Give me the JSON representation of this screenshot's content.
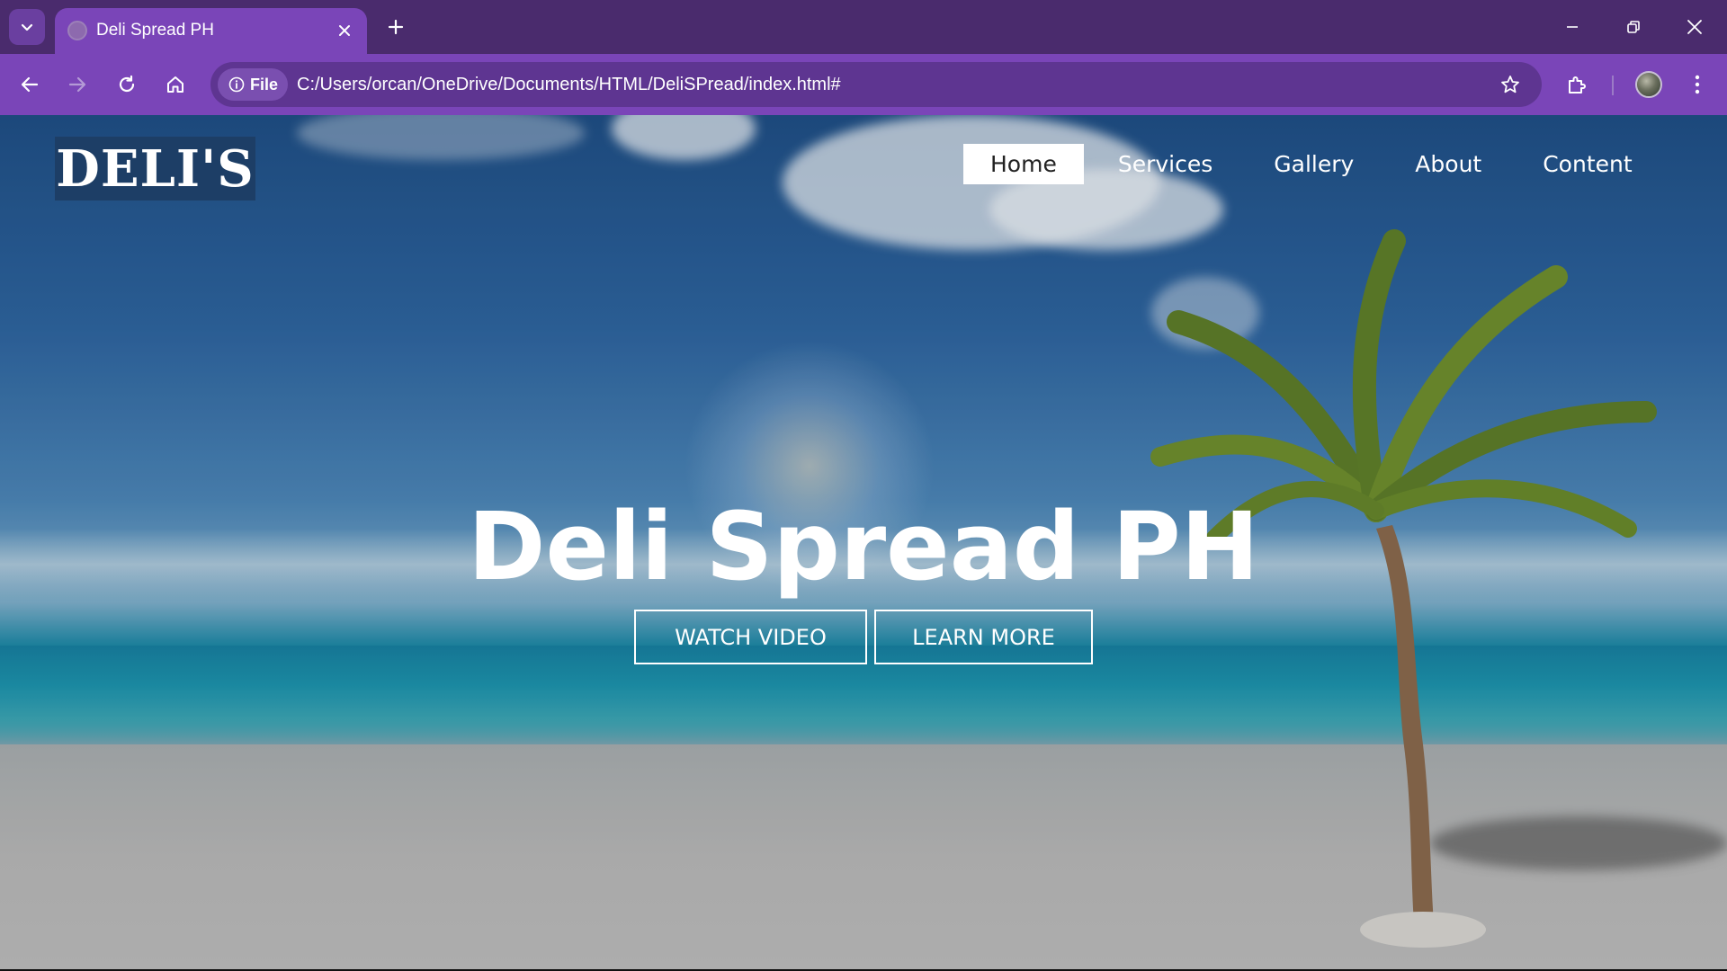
{
  "browser": {
    "tab": {
      "title": "Deli Spread PH",
      "favicon": "globe-icon"
    },
    "address": {
      "scheme_label": "File",
      "url": "C:/Users/orcan/OneDrive/Documents/HTML/DeliSPread/index.html#"
    },
    "icons": {
      "tab_search": "chevron-down-icon",
      "tab_close": "close-icon",
      "new_tab": "plus-icon",
      "minimize": "minimize-icon",
      "restore": "restore-icon",
      "close_window": "close-icon",
      "back": "arrow-left-icon",
      "forward": "arrow-right-icon",
      "reload": "reload-icon",
      "home": "home-icon",
      "info": "info-icon",
      "bookmark": "star-icon",
      "extensions": "puzzle-icon",
      "profile": "avatar",
      "menu": "kebab-menu-icon"
    },
    "colors": {
      "tabbar": "#4a2b6d",
      "toolbar": "#7a45b8",
      "omnibox": "#5e3591"
    }
  },
  "site": {
    "logo": "DELI'S",
    "nav": [
      {
        "label": "Home",
        "active": true
      },
      {
        "label": "Services",
        "active": false
      },
      {
        "label": "Gallery",
        "active": false
      },
      {
        "label": "About",
        "active": false
      },
      {
        "label": "Content",
        "active": false
      }
    ],
    "hero": {
      "title": "Deli Spread PH",
      "buttons": {
        "watch": "WATCH VIDEO",
        "learn": "LEARN MORE"
      }
    },
    "colors": {
      "logo_bg": "#1d3e66",
      "nav_active_bg": "#ffffff",
      "text": "#ffffff"
    }
  }
}
